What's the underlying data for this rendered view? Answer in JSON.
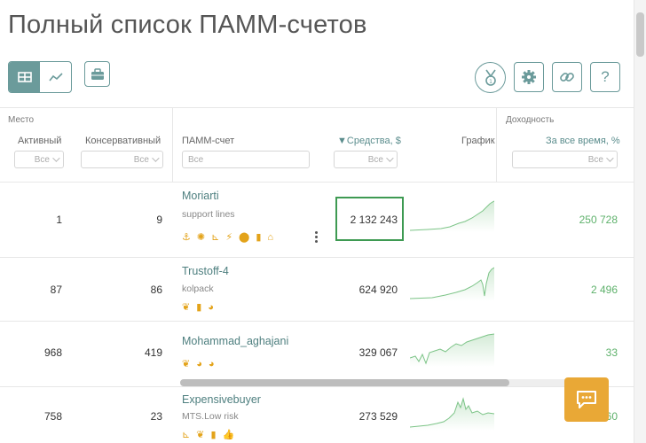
{
  "page": {
    "title": "Полный список ПАММ-счетов"
  },
  "toolbar": {
    "view_table": "table-view",
    "view_chart": "chart-view"
  },
  "header": {
    "group_place": "Место",
    "group_yield": "Доходность",
    "col_active": "Активный",
    "col_conservative": "Консервативный",
    "col_account": "ПАММ-счет",
    "col_funds": "▼Средства, $",
    "col_chart": "График",
    "col_yield": "За все время, %",
    "filter_all": "Все"
  },
  "accent": {
    "teal": "#6b9b9b",
    "green": "#5eb16b",
    "badge": "#e3a31a",
    "chat": "#e9a836",
    "highlight": "#3e9a52"
  },
  "rows": [
    {
      "active": "1",
      "conservative": "9",
      "name": "Moriarti",
      "sub": "support lines",
      "badges": [
        "⚓",
        "✺",
        "⊾",
        "⚡",
        "⬤",
        "▮",
        "⌂"
      ],
      "funds": "2 132 243",
      "yield": "250 728"
    },
    {
      "active": "87",
      "conservative": "86",
      "name": "Trustoff-4",
      "sub": "kolpack",
      "badges": [
        "❦",
        "▮",
        "◕"
      ],
      "funds": "624 920",
      "yield": "2 496"
    },
    {
      "active": "968",
      "conservative": "419",
      "name": "Mohammad_aghajani",
      "sub": "",
      "badges": [
        "❦",
        "◕",
        "◕"
      ],
      "funds": "329 067",
      "yield": "33"
    },
    {
      "active": "758",
      "conservative": "23",
      "name": "Expensivebuyer",
      "sub": "MTS.Low risk",
      "badges": [
        "⊾",
        "❦",
        "▮",
        "👍"
      ],
      "funds": "273 529",
      "yield": "60"
    }
  ]
}
